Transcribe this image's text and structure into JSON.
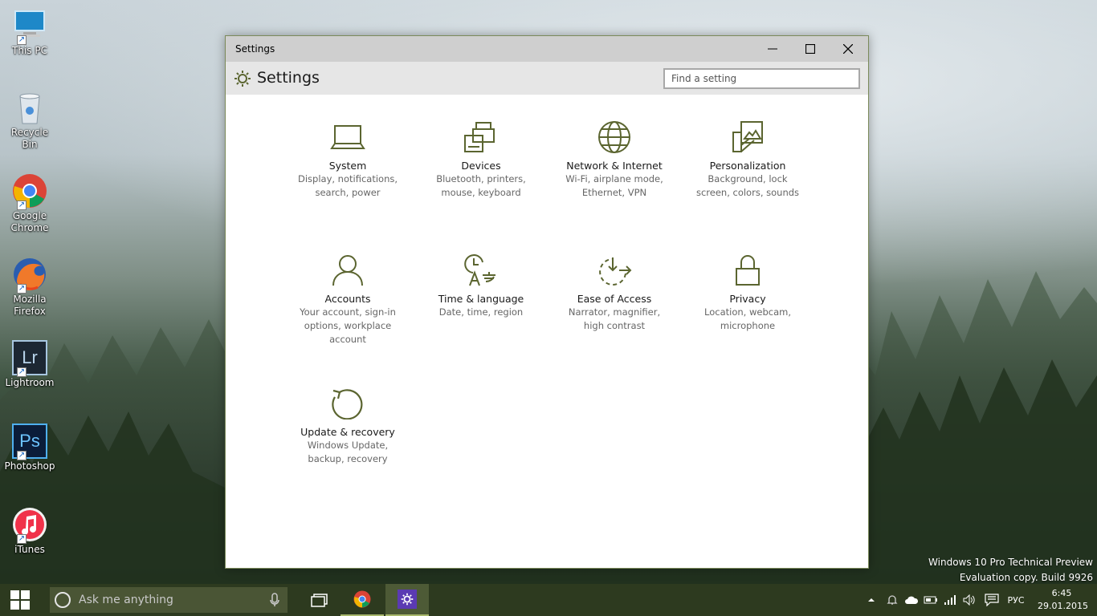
{
  "desktop": {
    "icons": [
      {
        "label": "This PC",
        "icon": "computer-icon"
      },
      {
        "label": "Recycle Bin",
        "icon": "recycle-bin-icon"
      },
      {
        "label_line1": "Google",
        "label_line2": "Chrome",
        "icon": "chrome-icon"
      },
      {
        "label_line1": "Mozilla",
        "label_line2": "Firefox",
        "icon": "firefox-icon"
      },
      {
        "label": "Lightroom",
        "icon": "lightroom-icon",
        "glyph": "Lr"
      },
      {
        "label": "Photoshop",
        "icon": "photoshop-icon",
        "glyph": "Ps"
      },
      {
        "label": "iTunes",
        "icon": "itunes-icon"
      }
    ],
    "shortcut_glyph": "↗"
  },
  "window": {
    "title": "Settings",
    "controls": {
      "minimize": "minimize-icon",
      "maximize": "maximize-icon",
      "close": "close-icon"
    },
    "header_title": "Settings",
    "search_placeholder": "Find a setting",
    "accent_color": "#5b6530",
    "categories": [
      {
        "name": "System",
        "desc1": "Display, notifications,",
        "desc2": "search, power",
        "icon": "laptop-icon"
      },
      {
        "name": "Devices",
        "desc1": "Bluetooth, printers,",
        "desc2": "mouse, keyboard",
        "icon": "devices-icon"
      },
      {
        "name": "Network & Internet",
        "desc1": "Wi-Fi, airplane mode,",
        "desc2": "Ethernet, VPN",
        "icon": "globe-icon"
      },
      {
        "name": "Personalization",
        "desc1": "Background, lock",
        "desc2": "screen, colors, sounds",
        "icon": "personalization-icon"
      },
      {
        "name": "Accounts",
        "desc1": "Your account, sign-in",
        "desc2": "options, workplace",
        "desc3": "account",
        "icon": "person-icon"
      },
      {
        "name": "Time & language",
        "desc1": "Date, time, region",
        "icon": "time-language-icon"
      },
      {
        "name": "Ease of Access",
        "desc1": "Narrator, magnifier,",
        "desc2": "high contrast",
        "icon": "ease-of-access-icon"
      },
      {
        "name": "Privacy",
        "desc1": "Location, webcam,",
        "desc2": "microphone",
        "icon": "lock-icon"
      },
      {
        "name": "Update & recovery",
        "desc1": "Windows Update,",
        "desc2": "backup, recovery",
        "icon": "update-icon"
      }
    ]
  },
  "watermark": {
    "line1": "Windows 10 Pro Technical Preview",
    "line2": "Evaluation copy. Build 9926"
  },
  "taskbar": {
    "search_placeholder": "Ask me anything",
    "language": "РУС",
    "time": "6:45",
    "date": "29.01.2015",
    "color": "#2d3a1f"
  }
}
